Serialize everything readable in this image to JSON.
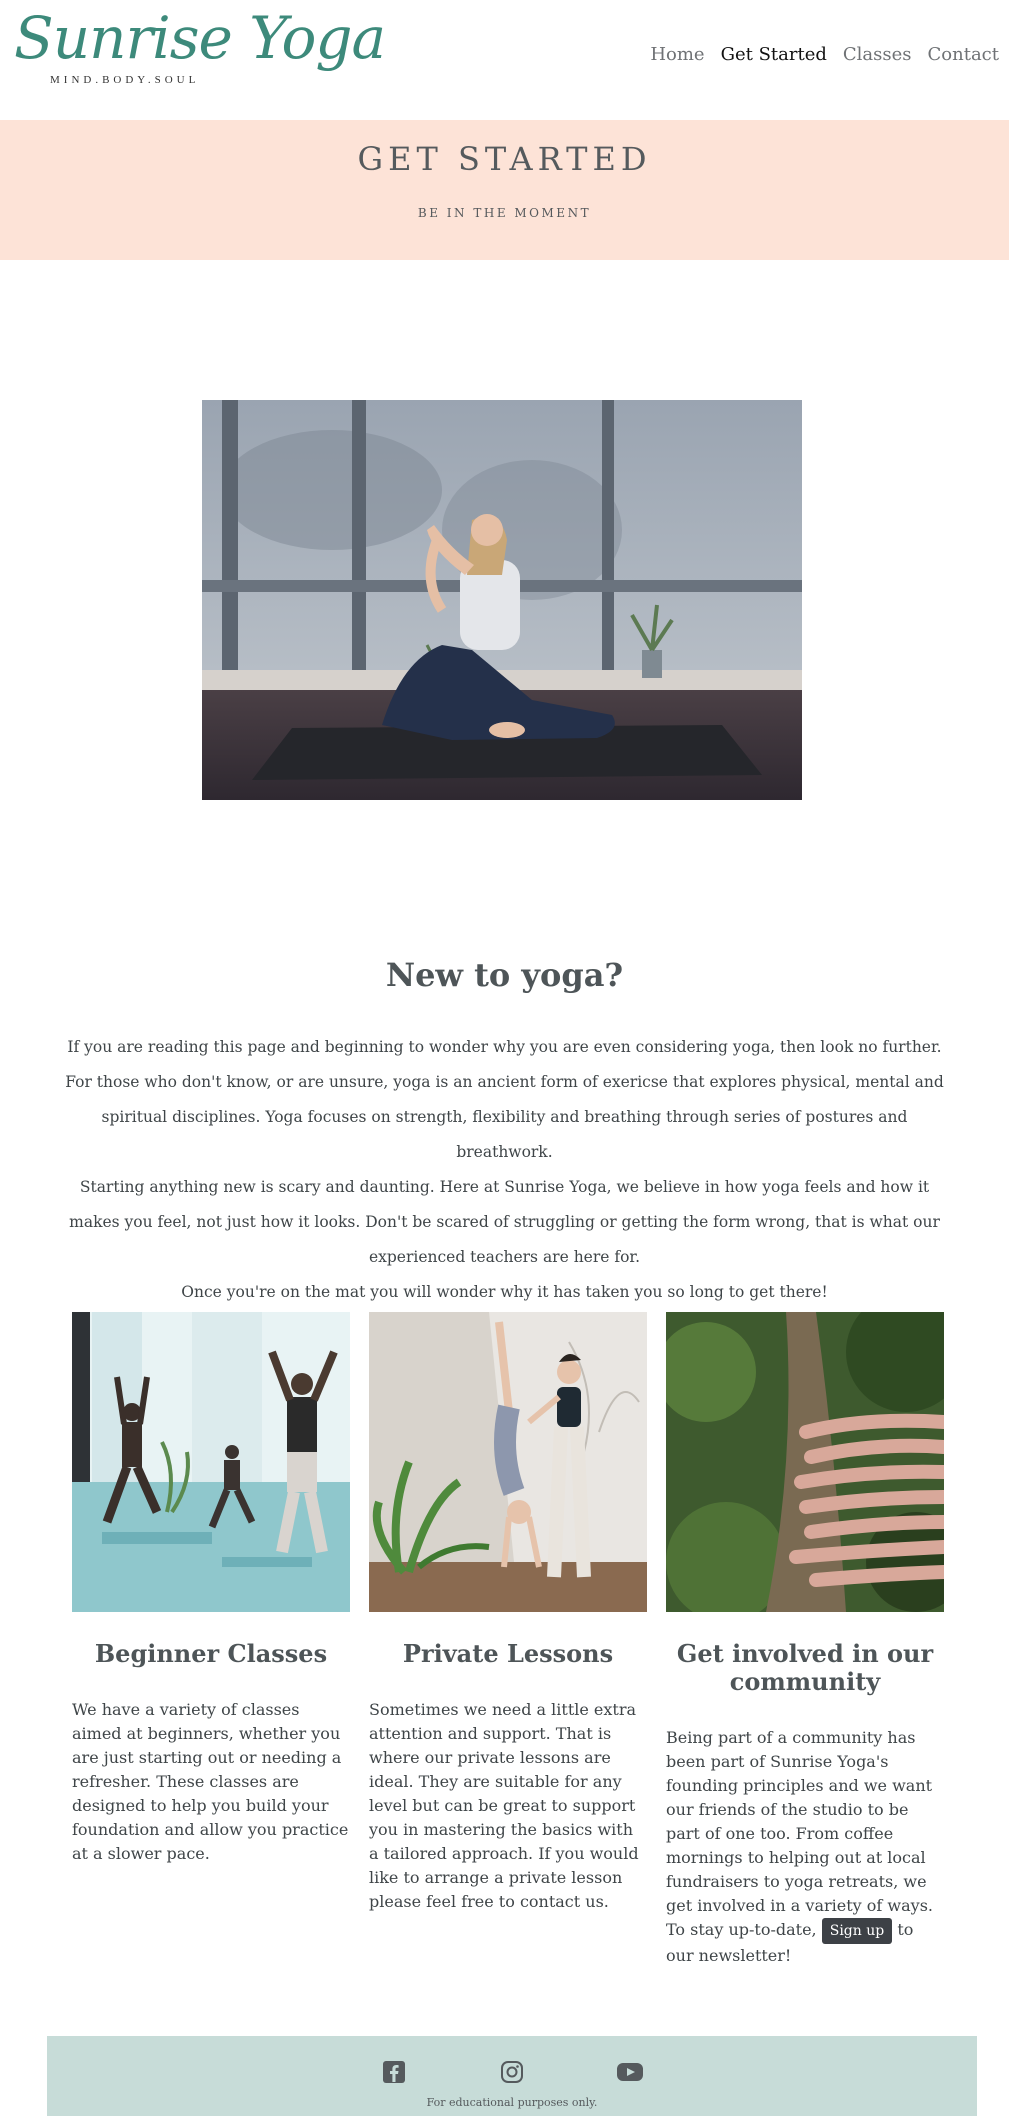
{
  "header": {
    "logo_text": "Sunrise Yoga",
    "logo_tagline": "MIND.BODY.SOUL",
    "nav": [
      {
        "label": "Home"
      },
      {
        "label": "Get Started"
      },
      {
        "label": "Classes"
      },
      {
        "label": "Contact"
      }
    ]
  },
  "banner": {
    "title": "GET STARTED",
    "subtitle": "BE IN THE MOMENT"
  },
  "intro": {
    "title": "New to yoga?",
    "lines": [
      "If you are reading this page and beginning to wonder why you are even considering yoga, then look no further.",
      "For those who don't know, or are unsure, yoga is an ancient form of exericse that explores physical, mental and spiritual disciplines. Yoga focuses on strength, flexibility and breathing through series of postures and breathwork.",
      "Starting anything new is scary and daunting. Here at Sunrise Yoga, we believe in how yoga feels and how it makes you feel, not just how it looks. Don't be scared of struggling or getting the form wrong, that is what our experienced teachers are here for.",
      "Once you're on the mat you will wonder why it has taken you so long to get there!"
    ]
  },
  "cards": [
    {
      "title": "Beginner Classes",
      "text": "We have a variety of classes aimed at beginners, whether you are just starting out or needing a refresher. These classes are designed to help you build your foundation and allow you practice at a slower pace."
    },
    {
      "title": "Private Lessons",
      "text": "Sometimes we need a little extra attention and support. That is where our private lessons are ideal. They are suitable for any level but can be great to support you in mastering the basics with a tailored approach. If you would like to arrange a private lesson please feel free to contact us."
    },
    {
      "title": "Get involved in our community",
      "text_before": "Being part of a community has been part of Sunrise Yoga's founding principles and we want our friends of the studio to be part of one too. From coffee mornings to helping out at local fundraisers to yoga retreats, we get involved in a variety of ways. To stay up-to-date,",
      "button": "Sign up",
      "text_after": "to our newsletter!"
    }
  ],
  "footer": {
    "icons": [
      "facebook-icon",
      "instagram-icon",
      "youtube-icon"
    ],
    "note": "For educational purposes only."
  },
  "colors": {
    "brand": "#3d8a7b",
    "banner_bg": "#fde3d7",
    "footer_bg": "#c7dcd8"
  }
}
